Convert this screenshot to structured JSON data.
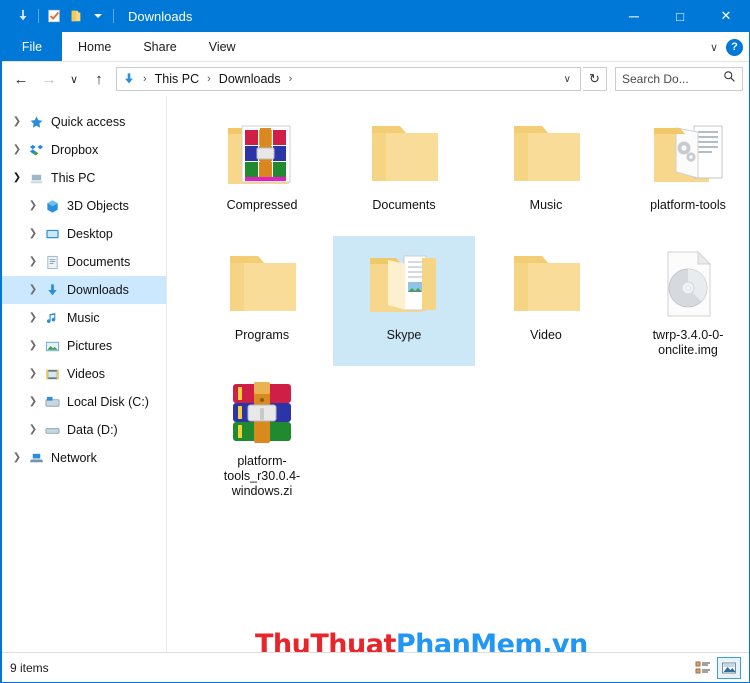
{
  "window": {
    "title": "Downloads",
    "accent_color": "#0078d7",
    "selection_color": "#cce8f7",
    "quick_access": [
      {
        "name": "downloads-arrow",
        "label": "Downloads"
      },
      {
        "name": "properties-check",
        "label": "Properties"
      },
      {
        "name": "new-folder",
        "label": "New folder"
      },
      {
        "name": "customize-chevron",
        "label": "Customize Quick Access Toolbar"
      }
    ],
    "controls": {
      "minimize": "─",
      "maximize": "□",
      "close": "✕"
    }
  },
  "ribbon": {
    "tabs": [
      {
        "label": "File",
        "active": true
      },
      {
        "label": "Home",
        "active": false
      },
      {
        "label": "Share",
        "active": false
      },
      {
        "label": "View",
        "active": false
      }
    ],
    "expand_chevron": "∨",
    "help_label": "?"
  },
  "address": {
    "back": "←",
    "forward": "→",
    "recent": "∨",
    "up": "↑",
    "crumbs": [
      "This PC",
      "Downloads"
    ],
    "separator": "›",
    "dropdown": "∨",
    "refresh": "↻"
  },
  "search": {
    "placeholder": "Search Do...",
    "icon": "search-icon"
  },
  "sidebar": {
    "items": [
      {
        "label": "Quick access",
        "icon": "star-icon",
        "level": 0,
        "twisty": "closed",
        "selected": false
      },
      {
        "label": "Dropbox",
        "icon": "dropbox-icon",
        "level": 0,
        "twisty": "closed",
        "selected": false
      },
      {
        "label": "This PC",
        "icon": "pc-icon",
        "level": 0,
        "twisty": "open",
        "selected": false
      },
      {
        "label": "3D Objects",
        "icon": "cube-icon",
        "level": 1,
        "twisty": "closed",
        "selected": false
      },
      {
        "label": "Desktop",
        "icon": "desktop-icon",
        "level": 1,
        "twisty": "closed",
        "selected": false
      },
      {
        "label": "Documents",
        "icon": "documents-icon",
        "level": 1,
        "twisty": "closed",
        "selected": false
      },
      {
        "label": "Downloads",
        "icon": "downloads-icon",
        "level": 1,
        "twisty": "closed",
        "selected": true
      },
      {
        "label": "Music",
        "icon": "music-icon",
        "level": 1,
        "twisty": "closed",
        "selected": false
      },
      {
        "label": "Pictures",
        "icon": "pictures-icon",
        "level": 1,
        "twisty": "closed",
        "selected": false
      },
      {
        "label": "Videos",
        "icon": "videos-icon",
        "level": 1,
        "twisty": "closed",
        "selected": false
      },
      {
        "label": "Local Disk (C:)",
        "icon": "disk-icon",
        "level": 1,
        "twisty": "closed",
        "selected": false
      },
      {
        "label": "Data (D:)",
        "icon": "drive-icon",
        "level": 1,
        "twisty": "closed",
        "selected": false
      },
      {
        "label": "Network",
        "icon": "network-icon",
        "level": 0,
        "twisty": "closed",
        "selected": false
      }
    ]
  },
  "files": {
    "items": [
      {
        "label": "Compressed",
        "type": "folder-with-rar-preview",
        "selected": false
      },
      {
        "label": "Documents",
        "type": "folder",
        "selected": false
      },
      {
        "label": "Music",
        "type": "folder",
        "selected": false
      },
      {
        "label": "platform-tools",
        "type": "folder-with-docs-preview",
        "selected": false
      },
      {
        "label": "Programs",
        "type": "folder",
        "selected": false
      },
      {
        "label": "Skype",
        "type": "folder-with-doc-preview",
        "selected": true
      },
      {
        "label": "Video",
        "type": "folder",
        "selected": false
      },
      {
        "label": "twrp-3.4.0-0-onclite.img",
        "type": "disc-image-file",
        "selected": false
      },
      {
        "label": "platform-tools_r30.0.4-windows.zi",
        "type": "winrar-archive",
        "selected": false
      }
    ]
  },
  "annotation": {
    "arrow_color": "#e8302a",
    "points_at": "platform-tools"
  },
  "watermark": {
    "part1": "ThuThuat",
    "part2": "PhanMem.vn",
    "color1": "#e8252a",
    "color2": "#2196f3"
  },
  "statusbar": {
    "item_count": "9 items",
    "views": [
      {
        "name": "details-view",
        "active": false
      },
      {
        "name": "large-icons-view",
        "active": true
      }
    ]
  }
}
